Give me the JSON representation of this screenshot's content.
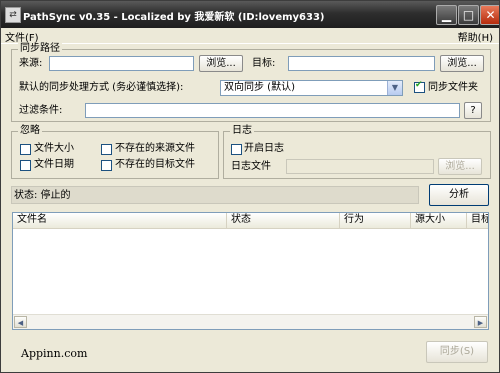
{
  "window": {
    "title": "PathSync v0.35 - Localized by 我爱新软 (ID:lovemy633)",
    "controls": {
      "minimize": "▁",
      "maximize": "□",
      "close": "✕"
    }
  },
  "menu": {
    "file": "文件(F)",
    "help": "帮助(H)"
  },
  "sync_paths": {
    "group_title": "同步路径",
    "source_label": "来源:",
    "source_value": "",
    "source_browse": "浏览...",
    "target_label": "目标:",
    "target_value": "",
    "target_browse": "浏览...",
    "mode_label": "默认的同步处理方式 (务必谨慎选择):",
    "mode_selected": "双向同步 (默认)",
    "sync_folders_label": "同步文件夹",
    "sync_folders_checked": true,
    "filter_label": "过滤条件:",
    "filter_value": "",
    "filter_help": "?"
  },
  "ignore": {
    "group_title": "忽略",
    "file_size": "文件大小",
    "file_date": "文件日期",
    "missing_source": "不存在的来源文件",
    "missing_target": "不存在的目标文件"
  },
  "log": {
    "group_title": "日志",
    "enable_label": "开启日志",
    "enable_checked": false,
    "log_file_label": "日志文件",
    "log_file_value": "",
    "browse": "浏览..."
  },
  "status": {
    "text": "状态: 停止的",
    "analyze_button": "分析"
  },
  "table": {
    "columns": [
      "文件名",
      "状态",
      "行为",
      "源大小",
      "目标"
    ]
  },
  "footer": {
    "brand": "Appinn.com",
    "sync_button": "同步(S)"
  }
}
